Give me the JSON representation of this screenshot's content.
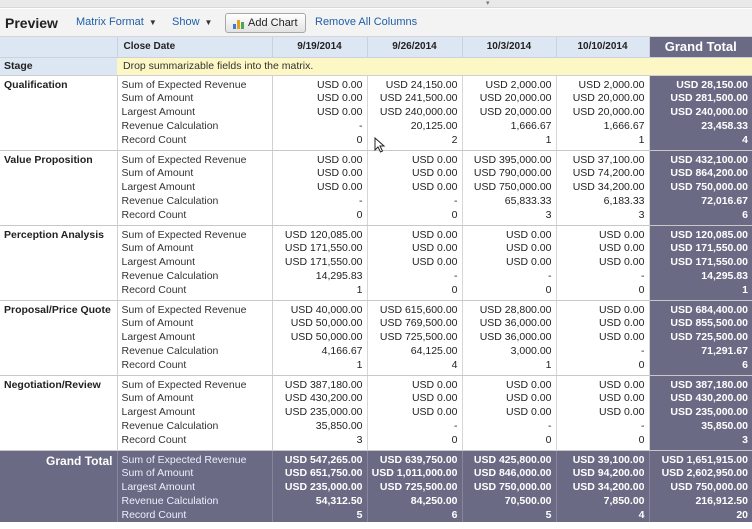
{
  "toolbar": {
    "title": "Preview",
    "matrix_format_label": "Matrix Format",
    "show_label": "Show",
    "add_chart_label": "Add Chart",
    "remove_columns_label": "Remove All Columns",
    "chart_icon": "bar-chart-icon"
  },
  "header": {
    "close_date_label": "Close Date",
    "columns": [
      "9/19/2014",
      "9/26/2014",
      "10/3/2014",
      "10/10/2014"
    ],
    "grand_total_label": "Grand Total"
  },
  "stage_row": {
    "label": "Stage",
    "drop_hint": "Drop summarizable fields into the matrix."
  },
  "measures": [
    "Sum of Expected Revenue",
    "Sum of Amount",
    "Largest Amount",
    "Revenue Calculation",
    "Record Count"
  ],
  "groups": [
    {
      "name": "Qualification",
      "cols": [
        [
          "USD 0.00",
          "USD 0.00",
          "USD 0.00",
          "-",
          "0"
        ],
        [
          "USD 24,150.00",
          "USD 241,500.00",
          "USD 240,000.00",
          "20,125.00",
          "2"
        ],
        [
          "USD 2,000.00",
          "USD 20,000.00",
          "USD 20,000.00",
          "1,666.67",
          "1"
        ],
        [
          "USD 2,000.00",
          "USD 20,000.00",
          "USD 20,000.00",
          "1,666.67",
          "1"
        ]
      ],
      "total": [
        "USD 28,150.00",
        "USD 281,500.00",
        "USD 240,000.00",
        "23,458.33",
        "4"
      ]
    },
    {
      "name": "Value Proposition",
      "cols": [
        [
          "USD 0.00",
          "USD 0.00",
          "USD 0.00",
          "-",
          "0"
        ],
        [
          "USD 0.00",
          "USD 0.00",
          "USD 0.00",
          "-",
          "0"
        ],
        [
          "USD 395,000.00",
          "USD 790,000.00",
          "USD 750,000.00",
          "65,833.33",
          "3"
        ],
        [
          "USD 37,100.00",
          "USD 74,200.00",
          "USD 34,200.00",
          "6,183.33",
          "3"
        ]
      ],
      "total": [
        "USD 432,100.00",
        "USD 864,200.00",
        "USD 750,000.00",
        "72,016.67",
        "6"
      ]
    },
    {
      "name": "Perception Analysis",
      "cols": [
        [
          "USD 120,085.00",
          "USD 171,550.00",
          "USD 171,550.00",
          "14,295.83",
          "1"
        ],
        [
          "USD 0.00",
          "USD 0.00",
          "USD 0.00",
          "-",
          "0"
        ],
        [
          "USD 0.00",
          "USD 0.00",
          "USD 0.00",
          "-",
          "0"
        ],
        [
          "USD 0.00",
          "USD 0.00",
          "USD 0.00",
          "-",
          "0"
        ]
      ],
      "total": [
        "USD 120,085.00",
        "USD 171,550.00",
        "USD 171,550.00",
        "14,295.83",
        "1"
      ]
    },
    {
      "name": "Proposal/Price Quote",
      "cols": [
        [
          "USD 40,000.00",
          "USD 50,000.00",
          "USD 50,000.00",
          "4,166.67",
          "1"
        ],
        [
          "USD 615,600.00",
          "USD 769,500.00",
          "USD 725,500.00",
          "64,125.00",
          "4"
        ],
        [
          "USD 28,800.00",
          "USD 36,000.00",
          "USD 36,000.00",
          "3,000.00",
          "1"
        ],
        [
          "USD 0.00",
          "USD 0.00",
          "USD 0.00",
          "-",
          "0"
        ]
      ],
      "total": [
        "USD 684,400.00",
        "USD 855,500.00",
        "USD 725,500.00",
        "71,291.67",
        "6"
      ]
    },
    {
      "name": "Negotiation/Review",
      "cols": [
        [
          "USD 387,180.00",
          "USD 430,200.00",
          "USD 235,000.00",
          "35,850.00",
          "3"
        ],
        [
          "USD 0.00",
          "USD 0.00",
          "USD 0.00",
          "-",
          "0"
        ],
        [
          "USD 0.00",
          "USD 0.00",
          "USD 0.00",
          "-",
          "0"
        ],
        [
          "USD 0.00",
          "USD 0.00",
          "USD 0.00",
          "-",
          "0"
        ]
      ],
      "total": [
        "USD 387,180.00",
        "USD 430,200.00",
        "USD 235,000.00",
        "35,850.00",
        "3"
      ]
    }
  ],
  "grand_total": {
    "label": "Grand Total",
    "cols": [
      [
        "USD 547,265.00",
        "USD 651,750.00",
        "USD 235,000.00",
        "54,312.50",
        "5"
      ],
      [
        "USD 639,750.00",
        "USD 1,011,000.00",
        "USD 725,500.00",
        "84,250.00",
        "6"
      ],
      [
        "USD 425,800.00",
        "USD 846,000.00",
        "USD 750,000.00",
        "70,500.00",
        "5"
      ],
      [
        "USD 39,100.00",
        "USD 94,200.00",
        "USD 34,200.00",
        "7,850.00",
        "4"
      ]
    ],
    "total": [
      "USD 1,651,915.00",
      "USD 2,602,950.00",
      "USD 750,000.00",
      "216,912.50",
      "20"
    ]
  },
  "colors": {
    "header_bg": "#dde7f3",
    "grand_total_bg": "#6a6a84",
    "drop_hint_bg": "#fdf7c6",
    "link": "#1f5fa8"
  }
}
